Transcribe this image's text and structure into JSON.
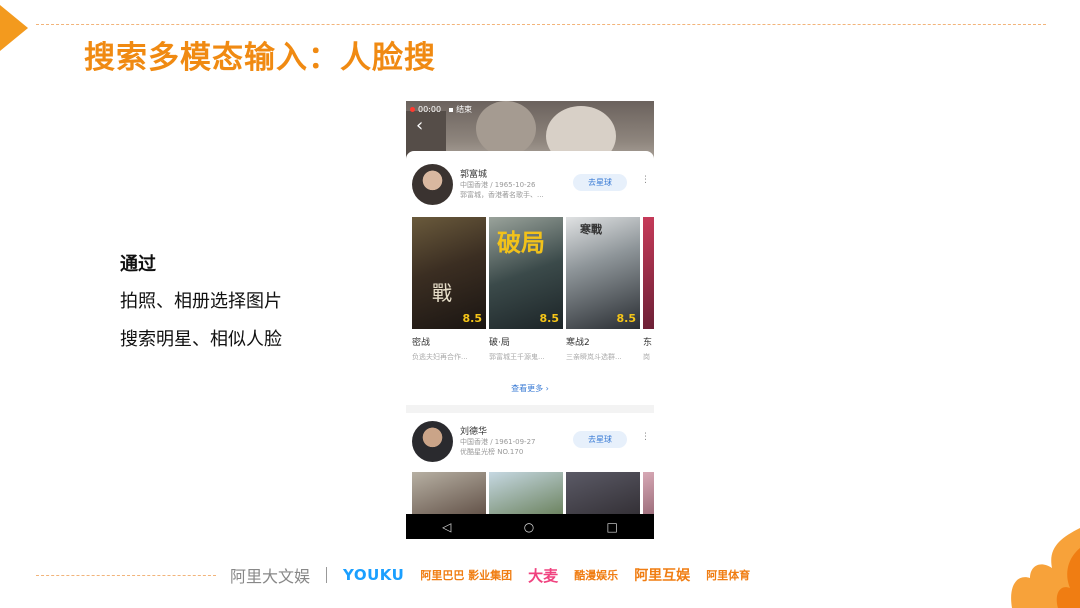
{
  "slide": {
    "title": "搜索多模态输入：人脸搜",
    "bullet_head": "通过",
    "bullet_lines": [
      "拍照、相册选择图片",
      "搜索明星、相似人脸"
    ]
  },
  "phone": {
    "status": {
      "time": "00:00",
      "end_label": "结束"
    },
    "back_icon": "‹",
    "cards": [
      {
        "name": "郭富城",
        "meta": "中国香港 / 1965-10-26",
        "desc": "郭富城，香港著名歌手、...",
        "follow_label": "去星球",
        "movies": [
          {
            "title": "密战",
            "desc": "负逃夫妇再合作...",
            "rating": "8.5"
          },
          {
            "title": "破·局",
            "desc": "郭富城王千源鬼...",
            "rating": "8.5"
          },
          {
            "title": "寒战2",
            "desc": "三亲瞬岚斗选群...",
            "rating": "8.5"
          },
          {
            "title": "东",
            "desc": "岗",
            "rating": ""
          }
        ],
        "see_more": "查看更多 ›"
      },
      {
        "name": "刘德华",
        "meta": "中国香港 / 1961-09-27",
        "desc": "优酷星光榜 NO.170",
        "follow_label": "去星球"
      }
    ],
    "nav": {
      "back": "◁",
      "home": "○",
      "recent": "□"
    }
  },
  "footer": {
    "logos": [
      "阿里大文娱",
      "YOUKU",
      "阿里巴巴 影业集团",
      "大麦",
      "酷漫娱乐",
      "阿里互娱",
      "阿里体育"
    ]
  },
  "colors": {
    "accent": "#f08a12",
    "link": "#3a7bd5"
  }
}
